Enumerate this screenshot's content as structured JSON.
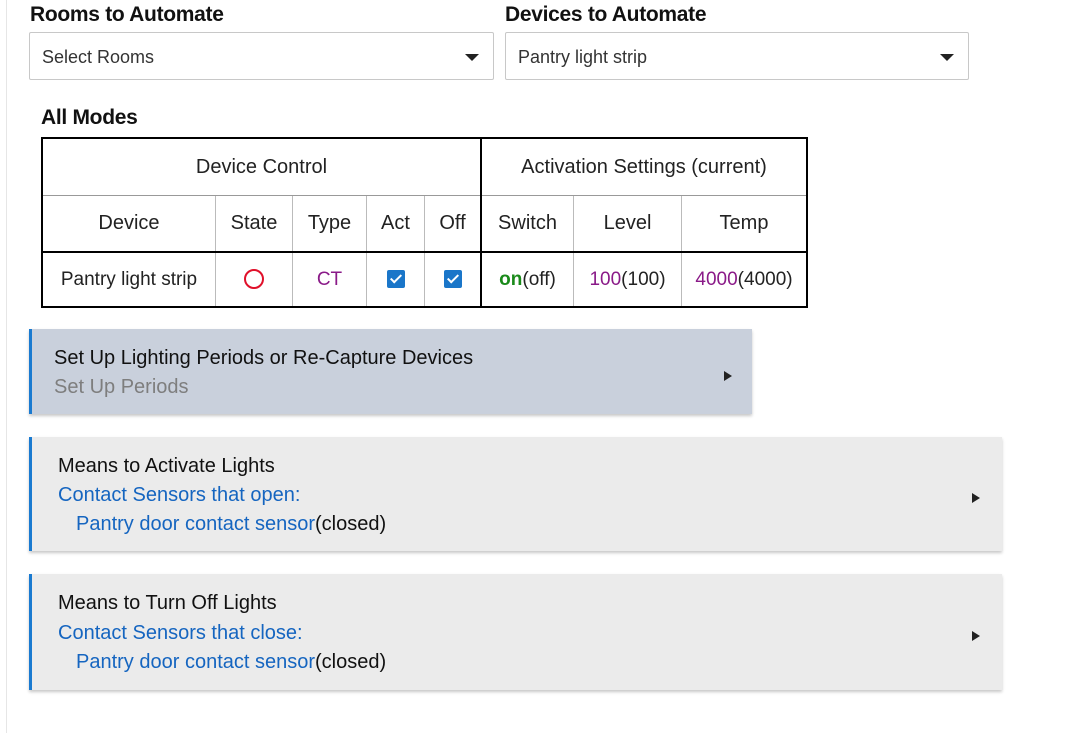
{
  "rooms": {
    "label": "Rooms to Automate",
    "value": "Select Rooms"
  },
  "devices": {
    "label": "Devices to Automate",
    "value": "Pantry light strip"
  },
  "modes_title": "All Modes",
  "table": {
    "group_device_control": "Device Control",
    "group_activation": "Activation Settings (current)",
    "columns": [
      "Device",
      "State",
      "Type",
      "Act",
      "Off",
      "Switch",
      "Level",
      "Temp"
    ],
    "row": {
      "device": "Pantry light strip",
      "type": "CT",
      "act_checked": true,
      "off_checked": true,
      "switch_setting": "on",
      "switch_current": "(off)",
      "level_setting": "100",
      "level_current": "(100)",
      "temp_setting": "4000",
      "temp_current": "(4000)"
    }
  },
  "panels": {
    "periods": {
      "title": "Set Up Lighting Periods or Re-Capture Devices",
      "subtitle": "Set Up Periods"
    },
    "activate": {
      "title": "Means to Activate Lights",
      "subtitle": "Contact Sensors that open:",
      "sensor": "Pantry door contact sensor",
      "sensor_state": "(closed)"
    },
    "turn_off": {
      "title": "Means to Turn Off Lights",
      "subtitle": "Contact Sensors that close:",
      "sensor": "Pantry door contact sensor",
      "sensor_state": "(closed)"
    }
  },
  "colors": {
    "accent_blue": "#1a7ad0",
    "link_blue": "#1565c0",
    "setting_purple": "#8a1a88",
    "on_green": "#1a8a1a",
    "state_red": "#e0102a",
    "periods_panel_bg": "#c9d0dc",
    "means_panel_bg": "#ebebeb"
  }
}
